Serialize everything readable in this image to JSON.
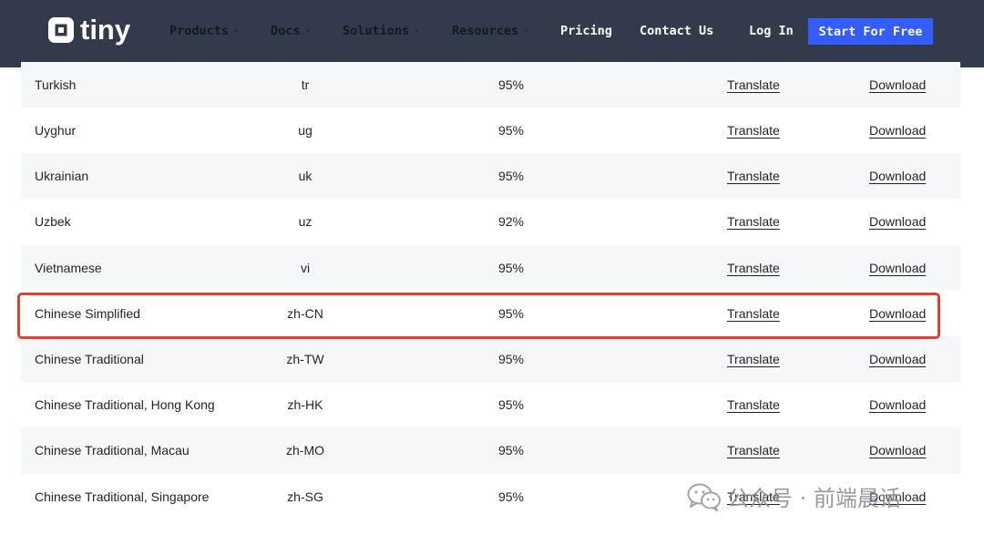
{
  "brand": {
    "name": "tiny"
  },
  "nav": {
    "items": [
      {
        "label": "Products",
        "has_menu": true
      },
      {
        "label": "Docs",
        "has_menu": true
      },
      {
        "label": "Solutions",
        "has_menu": true
      },
      {
        "label": "Resources",
        "has_menu": true
      },
      {
        "label": "Pricing",
        "has_menu": false
      },
      {
        "label": "Contact Us",
        "has_menu": false
      }
    ],
    "login": "Log In",
    "cta": "Start For Free",
    "caret": "›"
  },
  "languages": [
    {
      "name": "Turkish",
      "code": "tr",
      "percent": "95%",
      "translate": "Translate",
      "download": "Download"
    },
    {
      "name": "Uyghur",
      "code": "ug",
      "percent": "95%",
      "translate": "Translate",
      "download": "Download"
    },
    {
      "name": "Ukrainian",
      "code": "uk",
      "percent": "95%",
      "translate": "Translate",
      "download": "Download"
    },
    {
      "name": "Uzbek",
      "code": "uz",
      "percent": "92%",
      "translate": "Translate",
      "download": "Download"
    },
    {
      "name": "Vietnamese",
      "code": "vi",
      "percent": "95%",
      "translate": "Translate",
      "download": "Download"
    },
    {
      "name": "Chinese Simplified",
      "code": "zh-CN",
      "percent": "95%",
      "translate": "Translate",
      "download": "Download",
      "highlighted": true
    },
    {
      "name": "Chinese Traditional",
      "code": "zh-TW",
      "percent": "95%",
      "translate": "Translate",
      "download": "Download"
    },
    {
      "name": "Chinese Traditional, Hong Kong",
      "code": "zh-HK",
      "percent": "95%",
      "translate": "Translate",
      "download": "Download"
    },
    {
      "name": "Chinese Traditional, Macau",
      "code": "zh-MO",
      "percent": "95%",
      "translate": "Translate",
      "download": "Download"
    },
    {
      "name": "Chinese Traditional, Singapore",
      "code": "zh-SG",
      "percent": "95%",
      "translate": "Translate",
      "download": "Download"
    }
  ],
  "watermark": {
    "text": "公众号 · 前端晨话",
    "icon": "wechat-icon"
  },
  "colors": {
    "nav_bg": "#333a4b",
    "cta_bg": "#335dff",
    "row_shade": "#f6f7f9",
    "highlight": "#e2402b"
  }
}
